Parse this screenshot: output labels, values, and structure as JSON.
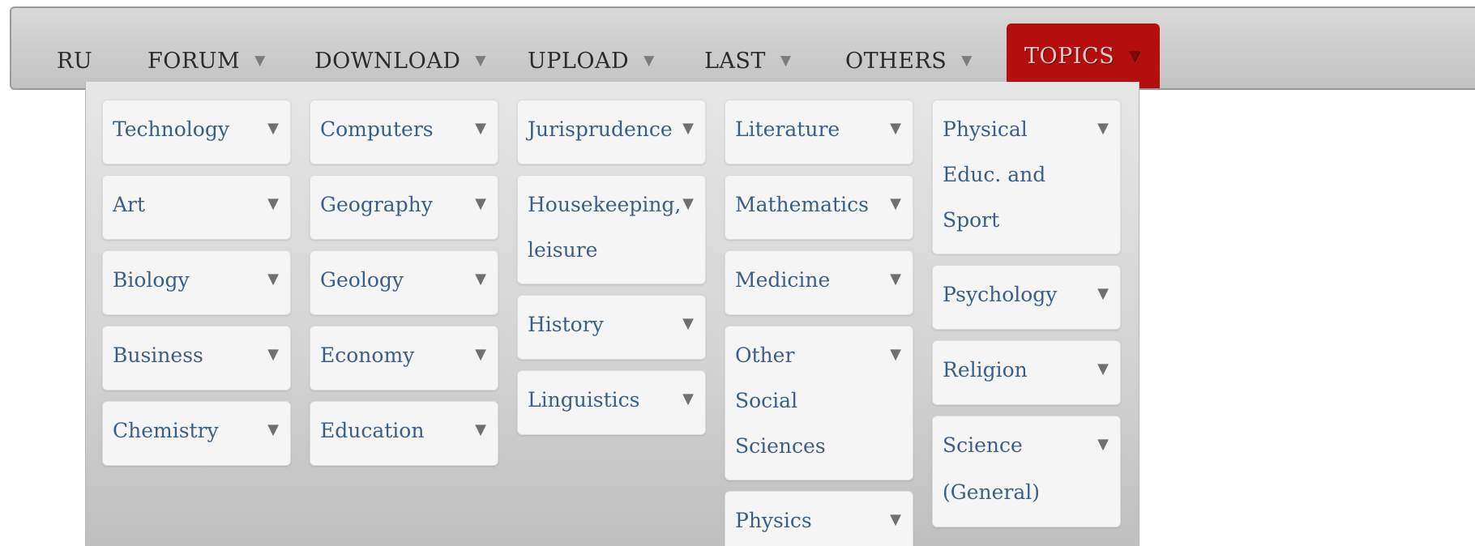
{
  "nav": {
    "items": [
      {
        "label": "RU",
        "caret": ""
      },
      {
        "label": "FORUM",
        "caret": "▼"
      },
      {
        "label": "DOWNLOAD",
        "caret": "▼"
      },
      {
        "label": "UPLOAD",
        "caret": "▼"
      },
      {
        "label": "LAST",
        "caret": "▼"
      },
      {
        "label": "OTHERS",
        "caret": "▼"
      },
      {
        "label": "TOPICS",
        "caret": "▼"
      }
    ],
    "active": "TOPICS",
    "active_color": "#b40e0e"
  },
  "topics": {
    "caret": "▼",
    "columns": [
      [
        "Technology",
        "Art",
        "Biology",
        "Business",
        "Chemistry"
      ],
      [
        "Computers",
        "Geography",
        "Geology",
        "Economy",
        "Education"
      ],
      [
        "Jurisprudence",
        "Housekeeping, leisure",
        "History",
        "Linguistics"
      ],
      [
        "Literature",
        "Mathematics",
        "Medicine",
        "Other Social Sciences",
        "Physics"
      ],
      [
        "Physical Educ. and Sport",
        "Psychology",
        "Religion",
        "Science (General)"
      ]
    ]
  }
}
